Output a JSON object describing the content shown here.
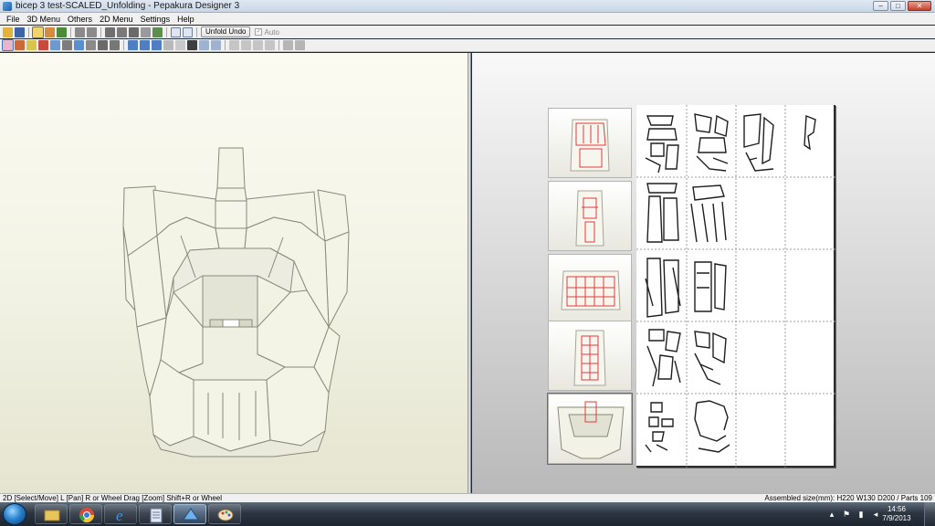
{
  "window": {
    "title": "bicep 3 test-SCALED_Unfolding - Pepakura Designer 3",
    "controls": {
      "minimize": "–",
      "maximize": "□",
      "close": "✕"
    }
  },
  "menu": [
    "File",
    "3D Menu",
    "Others",
    "2D Menu",
    "Settings",
    "Help"
  ],
  "toolbar": {
    "unfold_undo_label": "Unfold Undo",
    "auto_label": "Auto",
    "auto_checked": true
  },
  "status": {
    "hint": "2D [Select/Move] L [Pan] R or Wheel Drag [Zoom] Shift+R or Wheel",
    "assembled": "Assembled size(mm): H220 W130 D200 / Parts 109"
  },
  "taskbar": {
    "time": "14:56",
    "date": "7/9/2013",
    "apps": [
      "file-explorer",
      "chrome",
      "internet-explorer",
      "notepad",
      "pepakura-designer",
      "paint"
    ]
  },
  "colors": {
    "model_face": "#f3f3e6",
    "model_edge": "#8a8a78",
    "highlight_red": "#e23b3b",
    "sheet_grid": "#9c9c9c"
  }
}
